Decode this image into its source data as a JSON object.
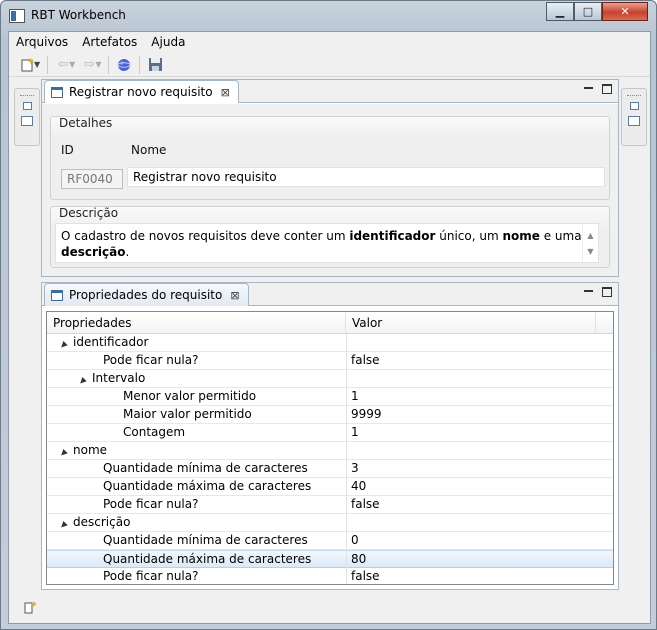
{
  "window": {
    "title": "RBT Workbench",
    "minimize": "▁",
    "maximize": "□",
    "close": "✕"
  },
  "menu": [
    "Arquivos",
    "Artefatos",
    "Ajuda"
  ],
  "toolbar": {
    "icons": [
      "new-wizard-icon",
      "back-icon",
      "forward-icon",
      "globe-icon",
      "save-icon"
    ]
  },
  "editor": {
    "tab_label": "Registrar novo requisito",
    "details": {
      "section_title": "Detalhes",
      "id_label": "ID",
      "name_label": "Nome",
      "id_value": "RF0040",
      "name_value": "Registrar novo requisito"
    },
    "description": {
      "section_title": "Descrição",
      "text_parts": [
        {
          "t": "O cadastro de novos requisitos deve conter um ",
          "b": false
        },
        {
          "t": "identificador",
          "b": true
        },
        {
          "t": " único, um ",
          "b": false
        },
        {
          "t": "nome",
          "b": true
        },
        {
          "t": " e uma ",
          "b": false
        },
        {
          "t": "descrição",
          "b": true
        },
        {
          "t": ".",
          "b": false
        }
      ]
    }
  },
  "properties_view": {
    "tab_label": "Propriedades do requisito",
    "columns": [
      "Propriedades",
      "Valor"
    ],
    "selected_index": 12,
    "rows": [
      {
        "label": "identificador",
        "value": "",
        "level": 0,
        "expander": "▲"
      },
      {
        "label": "Pode ficar nula?",
        "value": "false",
        "level": 1,
        "expander": ""
      },
      {
        "label": "Intervalo",
        "value": "",
        "level": 1,
        "expander": "▲"
      },
      {
        "label": "Menor valor permitido",
        "value": "1",
        "level": 2,
        "expander": ""
      },
      {
        "label": "Maior valor permitido",
        "value": "9999",
        "level": 2,
        "expander": ""
      },
      {
        "label": "Contagem",
        "value": "1",
        "level": 2,
        "expander": ""
      },
      {
        "label": "nome",
        "value": "",
        "level": 0,
        "expander": "▲"
      },
      {
        "label": "Quantidade mínima de caracteres",
        "value": "3",
        "level": 1,
        "expander": ""
      },
      {
        "label": "Quantidade máxima de caracteres",
        "value": "40",
        "level": 1,
        "expander": ""
      },
      {
        "label": "Pode ficar nula?",
        "value": "false",
        "level": 1,
        "expander": ""
      },
      {
        "label": "descrição",
        "value": "",
        "level": 0,
        "expander": "▲"
      },
      {
        "label": "Quantidade mínima de caracteres",
        "value": "0",
        "level": 1,
        "expander": ""
      },
      {
        "label": "Quantidade máxima de caracteres",
        "value": "80",
        "level": 1,
        "expander": ""
      },
      {
        "label": "Pode ficar nula?",
        "value": "false",
        "level": 1,
        "expander": ""
      }
    ]
  },
  "colors": {
    "accent": "#3e6b9c",
    "selection": "#dbe9f8",
    "frame": "#b8c4d1"
  }
}
